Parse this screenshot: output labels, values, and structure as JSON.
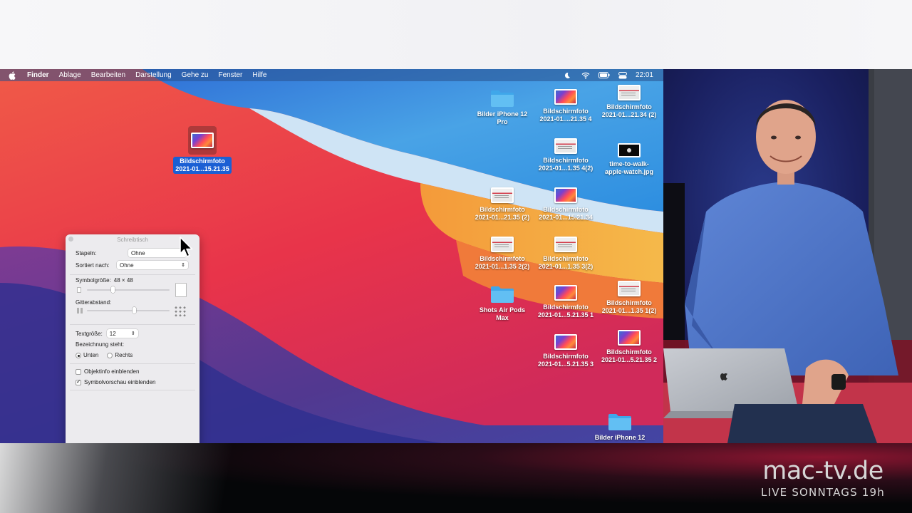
{
  "menubar": {
    "app": "Finder",
    "items": [
      "Ablage",
      "Bearbeiten",
      "Darstellung",
      "Gehe zu",
      "Fenster",
      "Hilfe"
    ],
    "clock": "22:01"
  },
  "selected_icon": {
    "line1": "Bildschirmfoto",
    "line2": "2021-01...15.21.35"
  },
  "desktop_icons": [
    {
      "kind": "folder",
      "line1": "Bilder iPhone 12",
      "line2": "Pro"
    },
    {
      "kind": "shot",
      "line1": "Bildschirmfoto",
      "line2": "2021-01....21.35 4"
    },
    {
      "kind": "doc",
      "line1": "Bildschirmfoto",
      "line2": "2021-01...21.34 (2)"
    },
    {
      "kind": "doc",
      "line1": "Bildschirmfoto",
      "line2": "2021-01...1.35 4(2)"
    },
    {
      "kind": "video",
      "line1": "time-to-walk-",
      "line2": "apple-watch.jpg"
    },
    {
      "kind": "doc",
      "line1": "Bildschirmfoto",
      "line2": "2021-01...21.35 (2)"
    },
    {
      "kind": "shot",
      "line1": "Bildschirmfoto",
      "line2": "2021-01...15.21.34"
    },
    {
      "kind": "doc",
      "line1": "Bildschirmfoto",
      "line2": "2021-01...1.35 2(2)"
    },
    {
      "kind": "doc",
      "line1": "Bildschirmfoto",
      "line2": "2021-01...1.35 3(2)"
    },
    {
      "kind": "folder",
      "line1": "Shots Air Pods",
      "line2": "Max"
    },
    {
      "kind": "shot",
      "line1": "Bildschirmfoto",
      "line2": "2021-01...5.21.35 1"
    },
    {
      "kind": "doc",
      "line1": "Bildschirmfoto",
      "line2": "2021-01...1.35 1(2)"
    },
    {
      "kind": "shot",
      "line1": "Bildschirmfoto",
      "line2": "2021-01...5.21.35 3"
    },
    {
      "kind": "shot",
      "line1": "Bildschirmfoto",
      "line2": "2021-01...5.21.35 2"
    },
    {
      "kind": "folder",
      "line1": "Bilder iPhone 12",
      "line2": ""
    }
  ],
  "panel": {
    "title": "Schreibtisch",
    "stapeln_label": "Stapeln:",
    "stapeln_value": "Ohne",
    "sortiert_label": "Sortiert nach:",
    "sortiert_value": "Ohne",
    "symbolgroesse_label": "Symbolgröße:",
    "symbolgroesse_value": "48 × 48",
    "symbolgroesse_level": 0.31,
    "gitterabstand_label": "Gitterabstand:",
    "gitterabstand_level": 0.58,
    "textgroesse_label": "Textgröße:",
    "textgroesse_value": "12",
    "bezeichnung_label": "Bezeichnung steht:",
    "radio_unten": "Unten",
    "radio_rechts": "Rechts",
    "checkbox_objektinfo": "Objektinfo einblenden",
    "checkbox_symbolvorschau": "Symbolvorschau einblenden"
  },
  "brand": {
    "name": "mac-tv.de",
    "tagline": "LIVE SONNTAGS 19h"
  }
}
